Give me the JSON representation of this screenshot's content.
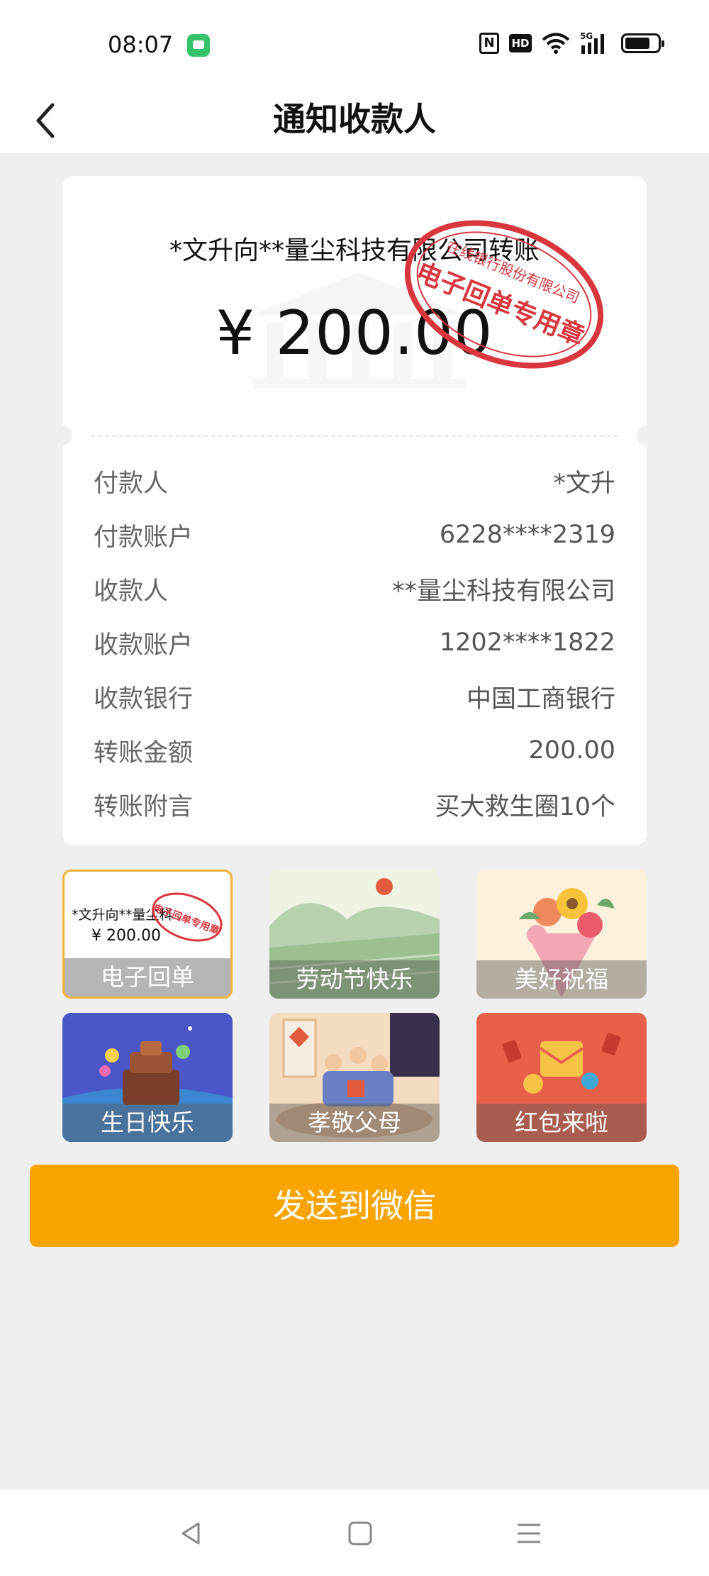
{
  "status_bar": {
    "time": "08:07",
    "icons": [
      "message-icon",
      "nfc-icon",
      "hd-icon",
      "wifi-icon",
      "5g-signal-icon",
      "battery-icon"
    ],
    "hd_label": "HD",
    "network_label": "5G"
  },
  "header": {
    "title": "通知收款人",
    "back_icon": "chevron-left-icon"
  },
  "receipt": {
    "title": "*文升向**量尘科技有限公司转账",
    "amount": "¥ 200.00",
    "stamp_text_top": "在线银行股份有限公司",
    "stamp_text_main": "电子回单专用章",
    "details": [
      {
        "label": "付款人",
        "value": "*文升"
      },
      {
        "label": "付款账户",
        "value": "6228****2319"
      },
      {
        "label": "收款人",
        "value": "**量尘科技有限公司"
      },
      {
        "label": "收款账户",
        "value": "1202****1822"
      },
      {
        "label": "收款银行",
        "value": "中国工商银行"
      },
      {
        "label": "转账金额",
        "value": "200.00"
      },
      {
        "label": "转账附言",
        "value": "买大救生圈10个"
      }
    ]
  },
  "templates": {
    "thumb_title": "*文升向**量尘科...",
    "thumb_amount": "¥ 200.00",
    "items": [
      {
        "label": "电子回单",
        "selected": true
      },
      {
        "label": "劳动节快乐",
        "selected": false
      },
      {
        "label": "美好祝福",
        "selected": false
      },
      {
        "label": "生日快乐",
        "selected": false
      },
      {
        "label": "孝敬父母",
        "selected": false
      },
      {
        "label": "红包来啦",
        "selected": false
      }
    ]
  },
  "send_button": {
    "label": "发送到微信"
  },
  "colors": {
    "accent": "#fba400",
    "stamp_red": "#d9363e",
    "selected_border": "#f1b23d",
    "background": "#efefef"
  }
}
